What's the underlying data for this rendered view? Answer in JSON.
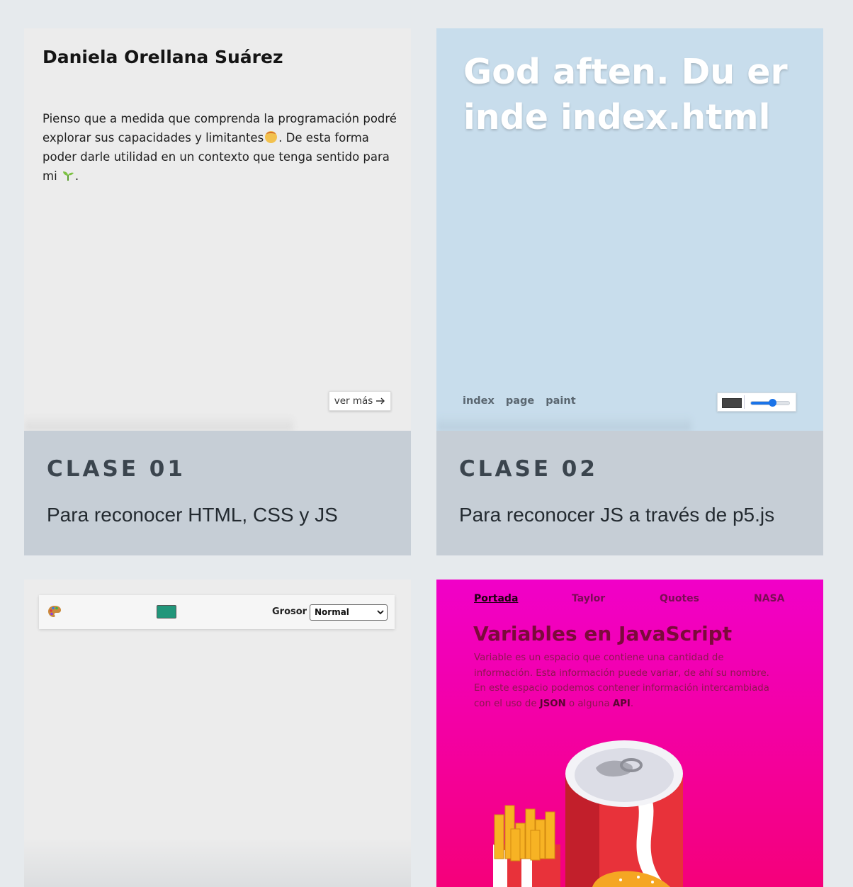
{
  "cards": [
    {
      "preview": {
        "name": "Daniela Orellana Suárez",
        "text_part1": "Pienso que a medida que comprenda la programación podré explorar sus capacidades y limitantes",
        "text_part2": ". De esta forma poder darle utilidad en un contexto que tenga sentido para mi",
        "text_part3": ".",
        "emoji_1": "exploding-head-emoji",
        "emoji_2": "seedling-emoji",
        "button_label": "ver más",
        "button_icon": "arrow-right-icon"
      },
      "label": "CLASE 01",
      "description": "Para reconocer HTML, CSS y JS"
    },
    {
      "preview": {
        "title": "God aften. Du er inde index.html",
        "nav": [
          "index",
          "page",
          "paint"
        ],
        "tool_color": "#444444",
        "tool_slider_value": 0.55
      },
      "label": "CLASE 02",
      "description": "Para reconocer JS a través de p5.js"
    },
    {
      "preview": {
        "palette_icon": "palette-icon",
        "swatch_color": "#21967a",
        "grosor_label": "Grosor",
        "grosor_value": "Normal"
      }
    },
    {
      "preview": {
        "nav": [
          {
            "label": "Portada",
            "active": true
          },
          {
            "label": "Taylor",
            "active": false
          },
          {
            "label": "Quotes",
            "active": false
          },
          {
            "label": "NASA",
            "active": false
          }
        ],
        "title": "Variables en JavaScript",
        "body_part1": "Variable es un espacio que contiene una cantidad de información. Esta información puede variar, de ahí su nombre. En este espacio podemos contener información intercambiada con el uso de",
        "body_bold1": "JSON",
        "body_part2": "o alguna",
        "body_bold2": "API",
        "body_part3": ".",
        "illustration": "soda-can-fries-burger-illustration"
      }
    }
  ],
  "colors": {
    "page_background": "#e6eaed",
    "caption_background": "#c6ced6",
    "card2_preview_background": "#c8ddec",
    "card4_gradient_top": "#f100c8",
    "card4_gradient_bottom": "#f5007a"
  }
}
